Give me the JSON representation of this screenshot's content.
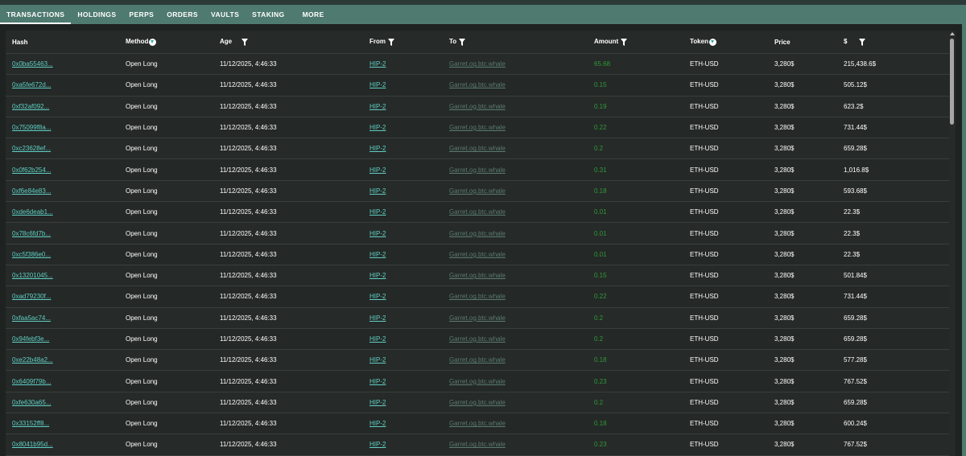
{
  "tabs": [
    "TRANSACTIONS",
    "HOLDINGS",
    "PERPS",
    "ORDERS",
    "VAULTS",
    "STAKING",
    "MORE"
  ],
  "active_tab": "TRANSACTIONS",
  "columns": {
    "hash": "Hash",
    "method": "Method",
    "age": "Age",
    "from": "From",
    "to": "To",
    "amount": "Amount",
    "token": "Token",
    "price": "Price",
    "usd": "$"
  },
  "colors": {
    "accent": "#4f7a6f",
    "link": "#5fd0c5",
    "muted_link": "#5a7a72",
    "amount_green": "#2f9a3a",
    "panel": "#262a28"
  },
  "rows": [
    {
      "hash": "0x0ba55463...",
      "method": "Open Long",
      "age": "11/12/2025, 4:46:33",
      "from": "HIP-2",
      "to": "Garret.og.btc.whale",
      "amount": "65.68",
      "token": "ETH-USD",
      "price": "3,280$",
      "usd": "215,438.6$"
    },
    {
      "hash": "0xa5fe672d...",
      "method": "Open Long",
      "age": "11/12/2025, 4:46:33",
      "from": "HIP-2",
      "to": "Garret.og.btc.whale",
      "amount": "0.15",
      "token": "ETH-USD",
      "price": "3,280$",
      "usd": "505.12$"
    },
    {
      "hash": "0xf32af092...",
      "method": "Open Long",
      "age": "11/12/2025, 4:46:33",
      "from": "HIP-2",
      "to": "Garret.og.btc.whale",
      "amount": "0.19",
      "token": "ETH-USD",
      "price": "3,280$",
      "usd": "623.2$"
    },
    {
      "hash": "0x75099f8a...",
      "method": "Open Long",
      "age": "11/12/2025, 4:46:33",
      "from": "HIP-2",
      "to": "Garret.og.btc.whale",
      "amount": "0.22",
      "token": "ETH-USD",
      "price": "3,280$",
      "usd": "731.44$"
    },
    {
      "hash": "0xc23628ef...",
      "method": "Open Long",
      "age": "11/12/2025, 4:46:33",
      "from": "HIP-2",
      "to": "Garret.og.btc.whale",
      "amount": "0.2",
      "token": "ETH-USD",
      "price": "3,280$",
      "usd": "659.28$"
    },
    {
      "hash": "0x0f62b254...",
      "method": "Open Long",
      "age": "11/12/2025, 4:46:33",
      "from": "HIP-2",
      "to": "Garret.og.btc.whale",
      "amount": "0.31",
      "token": "ETH-USD",
      "price": "3,280$",
      "usd": "1,016.8$"
    },
    {
      "hash": "0xf6e84e83...",
      "method": "Open Long",
      "age": "11/12/2025, 4:46:33",
      "from": "HIP-2",
      "to": "Garret.og.btc.whale",
      "amount": "0.18",
      "token": "ETH-USD",
      "price": "3,280$",
      "usd": "593.68$"
    },
    {
      "hash": "0xde6deab1...",
      "method": "Open Long",
      "age": "11/12/2025, 4:46:33",
      "from": "HIP-2",
      "to": "Garret.og.btc.whale",
      "amount": "0.01",
      "token": "ETH-USD",
      "price": "3,280$",
      "usd": "22.3$"
    },
    {
      "hash": "0x78c6fd7b...",
      "method": "Open Long",
      "age": "11/12/2025, 4:46:33",
      "from": "HIP-2",
      "to": "Garret.og.btc.whale",
      "amount": "0.01",
      "token": "ETH-USD",
      "price": "3,280$",
      "usd": "22.3$"
    },
    {
      "hash": "0xc5f386e0...",
      "method": "Open Long",
      "age": "11/12/2025, 4:46:33",
      "from": "HIP-2",
      "to": "Garret.og.btc.whale",
      "amount": "0.01",
      "token": "ETH-USD",
      "price": "3,280$",
      "usd": "22.3$"
    },
    {
      "hash": "0x13201045...",
      "method": "Open Long",
      "age": "11/12/2025, 4:46:33",
      "from": "HIP-2",
      "to": "Garret.og.btc.whale",
      "amount": "0.15",
      "token": "ETH-USD",
      "price": "3,280$",
      "usd": "501.84$"
    },
    {
      "hash": "0xad79230f...",
      "method": "Open Long",
      "age": "11/12/2025, 4:46:33",
      "from": "HIP-2",
      "to": "Garret.og.btc.whale",
      "amount": "0.22",
      "token": "ETH-USD",
      "price": "3,280$",
      "usd": "731.44$"
    },
    {
      "hash": "0xfaa5ac74...",
      "method": "Open Long",
      "age": "11/12/2025, 4:46:33",
      "from": "HIP-2",
      "to": "Garret.og.btc.whale",
      "amount": "0.2",
      "token": "ETH-USD",
      "price": "3,280$",
      "usd": "659.28$"
    },
    {
      "hash": "0x94febf3e...",
      "method": "Open Long",
      "age": "11/12/2025, 4:46:33",
      "from": "HIP-2",
      "to": "Garret.og.btc.whale",
      "amount": "0.2",
      "token": "ETH-USD",
      "price": "3,280$",
      "usd": "659.28$"
    },
    {
      "hash": "0xe22b48a2...",
      "method": "Open Long",
      "age": "11/12/2025, 4:46:33",
      "from": "HIP-2",
      "to": "Garret.og.btc.whale",
      "amount": "0.18",
      "token": "ETH-USD",
      "price": "3,280$",
      "usd": "577.28$"
    },
    {
      "hash": "0x6409f79b...",
      "method": "Open Long",
      "age": "11/12/2025, 4:46:33",
      "from": "HIP-2",
      "to": "Garret.og.btc.whale",
      "amount": "0.23",
      "token": "ETH-USD",
      "price": "3,280$",
      "usd": "767.52$"
    },
    {
      "hash": "0xfe630a65...",
      "method": "Open Long",
      "age": "11/12/2025, 4:46:33",
      "from": "HIP-2",
      "to": "Garret.og.btc.whale",
      "amount": "0.2",
      "token": "ETH-USD",
      "price": "3,280$",
      "usd": "659.28$"
    },
    {
      "hash": "0x33152ff8...",
      "method": "Open Long",
      "age": "11/12/2025, 4:46:33",
      "from": "HIP-2",
      "to": "Garret.og.btc.whale",
      "amount": "0.18",
      "token": "ETH-USD",
      "price": "3,280$",
      "usd": "600.24$"
    },
    {
      "hash": "0x8041b95d...",
      "method": "Open Long",
      "age": "11/12/2025, 4:46:33",
      "from": "HIP-2",
      "to": "Garret.og.btc.whale",
      "amount": "0.23",
      "token": "ETH-USD",
      "price": "3,280$",
      "usd": "767.52$"
    }
  ]
}
